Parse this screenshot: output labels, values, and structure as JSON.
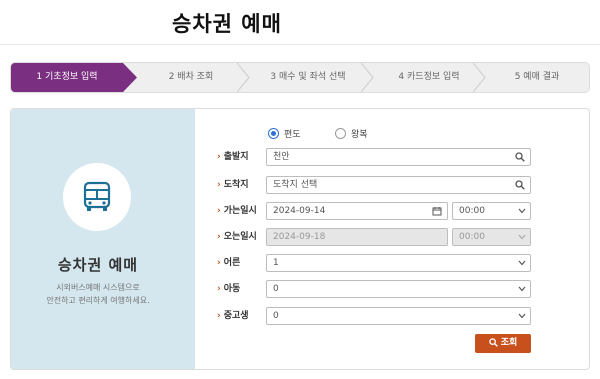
{
  "page": {
    "title": "승차권 예매"
  },
  "steps": [
    {
      "label": "1 기초정보 입력",
      "active": true
    },
    {
      "label": "2 배차 조회",
      "active": false
    },
    {
      "label": "3 매수 및 좌석 선택",
      "active": false
    },
    {
      "label": "4 카드정보 입력",
      "active": false
    },
    {
      "label": "5 예매 결과",
      "active": false
    }
  ],
  "left": {
    "icon": "bus-icon",
    "title": "승차권 예매",
    "desc_line1": "시외버스예매 시스템으로",
    "desc_line2": "안전하고 편리하게 여행하세요."
  },
  "trip_type": {
    "one_way": "편도",
    "round_trip": "왕복",
    "selected": "편도"
  },
  "form": {
    "departure": {
      "label": "출발지",
      "value": "천안"
    },
    "arrival": {
      "label": "도착지",
      "placeholder": "도착지 선택"
    },
    "depart_date": {
      "label": "가는일시",
      "date": "2024-09-14",
      "time": "00:00"
    },
    "return_date": {
      "label": "오는일시",
      "date": "2024-09-18",
      "time": "00:00"
    },
    "adult": {
      "label": "어른",
      "value": "1"
    },
    "child": {
      "label": "아동",
      "value": "0"
    },
    "student": {
      "label": "중고생",
      "value": "0"
    },
    "search_label": "조회"
  },
  "colors": {
    "accent": "#7b2f80",
    "button": "#c8501c",
    "left_panel": "#d4e6ee"
  }
}
